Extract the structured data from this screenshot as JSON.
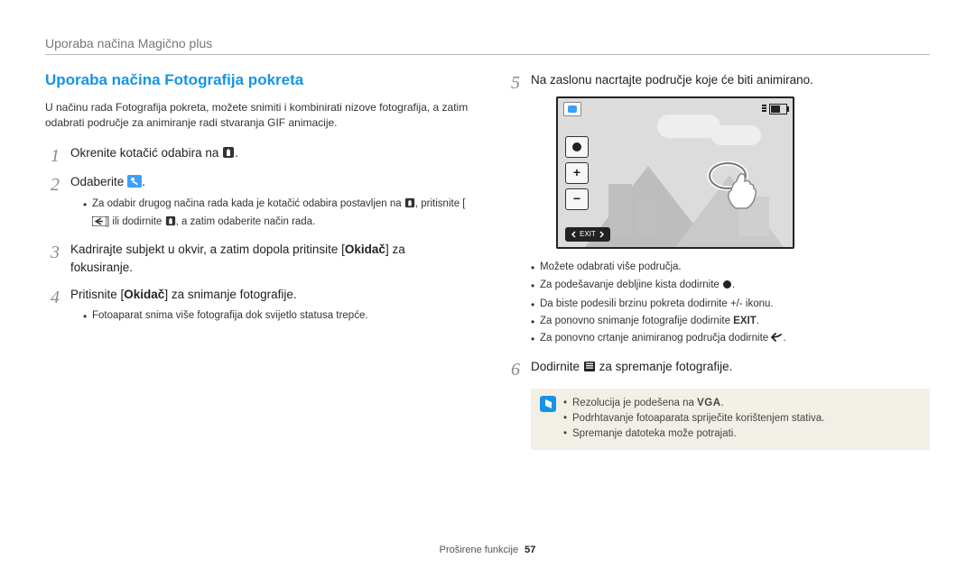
{
  "header": "Uporaba načina Magično plus",
  "left": {
    "title": "Uporaba načina Fotografija pokreta",
    "intro": "U načinu rada Fotografija pokreta, možete snimiti i kombinirati nizove fotografija, a zatim odabrati područje za animiranje radi stvaranja GIF animacije.",
    "step1": {
      "text": "Okrenite kotačić odabira na",
      "suffix": "."
    },
    "step2": {
      "text": "Odaberite",
      "suffix": ".",
      "sub_a_1": "Za odabir drugog načina rada kada je kotačić odabira postavljen na",
      "sub_a_2": ", pritisnite [",
      "sub_a_3": "] ili dodirnite",
      "sub_a_4": ", a zatim odaberite način rada."
    },
    "step3": {
      "pre": "Kadrirajte subjekt u okvir, a zatim dopola pritinsite [",
      "bold": "Okidač",
      "post": "] za fokusiranje."
    },
    "step4": {
      "pre": "Pritisnite [",
      "bold": "Okidač",
      "post": "] za snimanje fotografije.",
      "sub": "Fotoaparat snima više fotografija dok svijetlo statusa trepće."
    }
  },
  "right": {
    "step5": "Na zaslonu nacrtajte područje koje će biti animirano.",
    "exit_label": "EXIT",
    "bullets": {
      "b1": "Možete odabrati više područja.",
      "b2_pre": "Za podešavanje debljine kista dodirnite",
      "b2_post": ".",
      "b3": "Da biste podesili brzinu pokreta dodirnite +/- ikonu.",
      "b4_pre": "Za ponovno snimanje fotografije dodirnite ",
      "b4_bold": "EXIT",
      "b4_post": ".",
      "b5_pre": "Za ponovno crtanje animiranog područja dodirnite",
      "b5_post": "."
    },
    "step6": {
      "pre": "Dodirnite",
      "post": "za spremanje fotografije."
    },
    "tips": {
      "t1_pre": "Rezolucija je podešena na",
      "t1_bold": "VGA",
      "t1_post": ".",
      "t2": "Podrhtavanje fotoaparata spriječite korištenjem stativa.",
      "t3": "Spremanje datoteka može potrajati."
    }
  },
  "footer": {
    "section": "Proširene funkcije",
    "page": "57"
  }
}
